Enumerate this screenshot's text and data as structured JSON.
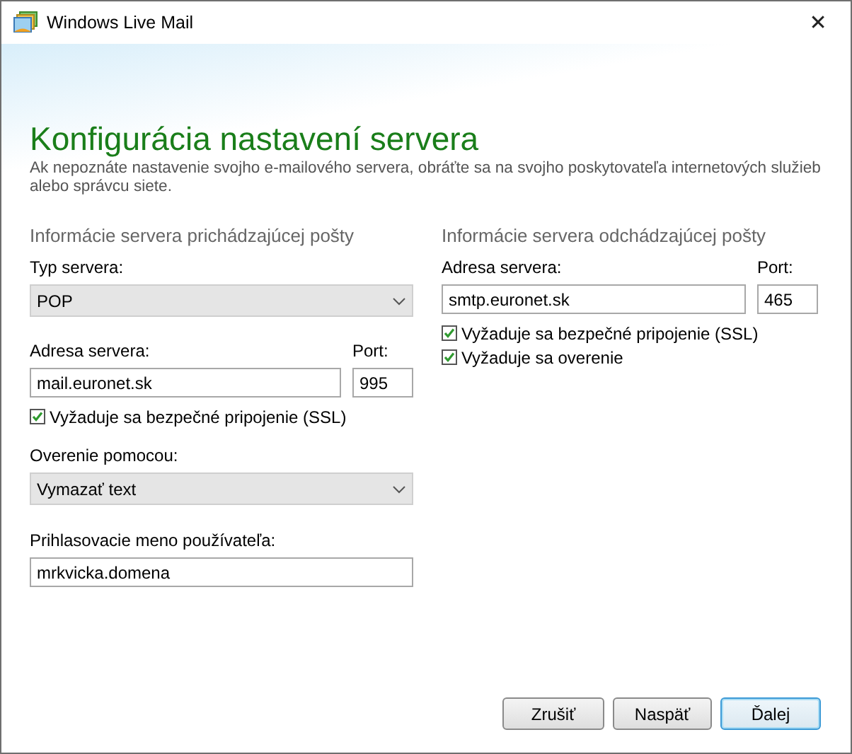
{
  "window": {
    "title": "Windows Live Mail",
    "close": "✕"
  },
  "heading": "Konfigurácia nastavení servera",
  "description": "Ak nepoznáte nastavenie svojho e-mailového servera, obráťte sa na svojho poskytovateľa internetových služieb alebo správcu siete.",
  "incoming": {
    "heading": "Informácie servera prichádzajúcej pošty",
    "server_type": {
      "label": "Typ servera:",
      "value": "POP"
    },
    "server_address": {
      "label": "Adresa servera:",
      "value": "mail.euronet.sk"
    },
    "port": {
      "label": "Port:",
      "value": "995"
    },
    "ssl": {
      "label": "Vyžaduje sa bezpečné pripojenie (SSL)",
      "checked": true
    },
    "authentication": {
      "label": "Overenie pomocou:",
      "value": "Vymazať text"
    },
    "login": {
      "label": "Prihlasovacie meno používateľa:",
      "value": "mrkvicka.domena"
    }
  },
  "outgoing": {
    "heading": "Informácie servera odchádzajúcej pošty",
    "server_address": {
      "label": "Adresa servera:",
      "value": "smtp.euronet.sk"
    },
    "port": {
      "label": "Port:",
      "value": "465"
    },
    "ssl": {
      "label": "Vyžaduje sa bezpečné pripojenie (SSL)",
      "checked": true
    },
    "requires_auth": {
      "label": "Vyžaduje sa overenie",
      "checked": true
    }
  },
  "buttons": [
    {
      "label": "Zrušiť",
      "default": false
    },
    {
      "label": "Naspäť",
      "default": false
    },
    {
      "label": "Ďalej",
      "default": true
    }
  ]
}
